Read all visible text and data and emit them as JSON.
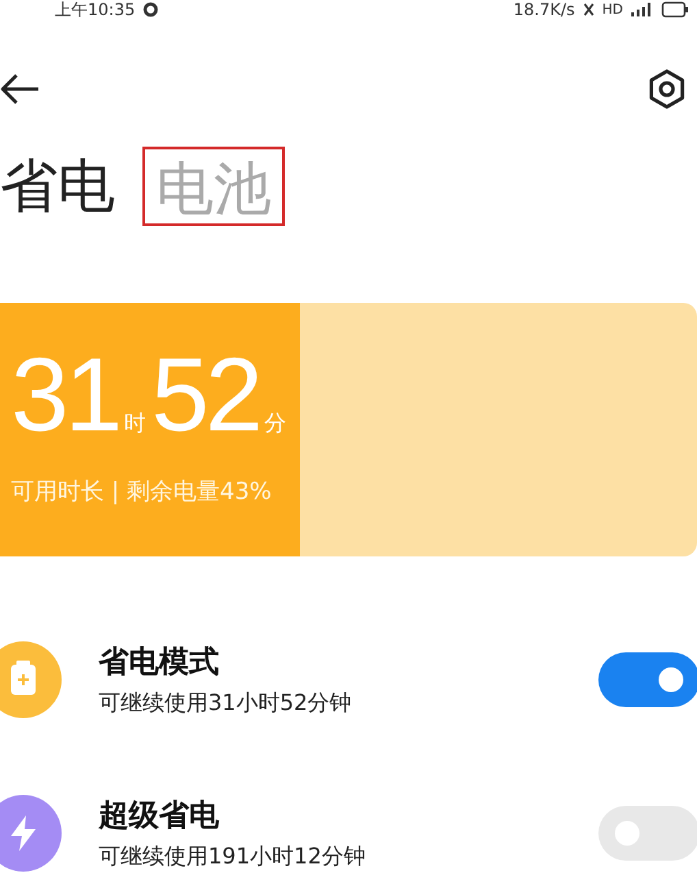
{
  "status_bar": {
    "time": "上午10:35",
    "speed": "18.7K/s",
    "network": "HD"
  },
  "tabs": [
    {
      "label": "省电",
      "selected": true,
      "highlighted": false
    },
    {
      "label": "电池",
      "selected": false,
      "highlighted": true
    }
  ],
  "battery": {
    "level": 0.43,
    "hours": "31",
    "hours_unit": "时",
    "minutes": "52",
    "minutes_unit": "分",
    "caption": "可用时长 | 剩余电量43%"
  },
  "modes": [
    {
      "title": "省电模式",
      "subtitle": "可继续使用31小时52分钟",
      "color": "#fbbd3c",
      "on": true
    },
    {
      "title": "超级省电",
      "subtitle": "可继续使用191小时12分钟",
      "color": "#a48cf4",
      "on": false
    }
  ]
}
